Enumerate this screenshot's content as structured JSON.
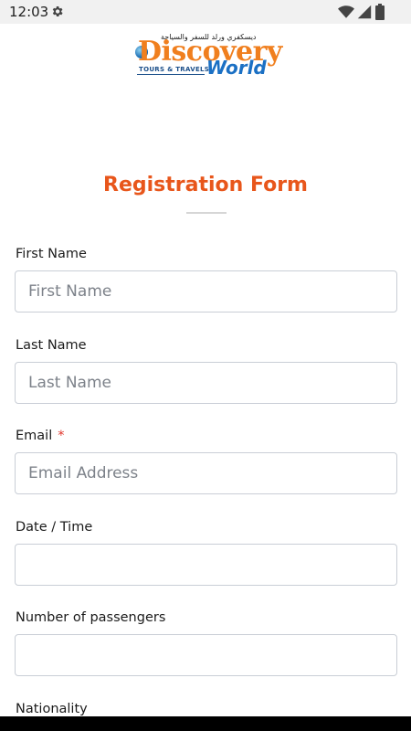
{
  "status_bar": {
    "time": "12:03",
    "icons": [
      "gear-icon",
      "wifi-icon",
      "signal-icon",
      "battery-icon"
    ]
  },
  "logo": {
    "arabic_text": "ديسكفري ورلد للسفر والسياحة",
    "brand_primary": "Discovery",
    "brand_secondary": "World",
    "tagline": "TOURS & TRAVELS"
  },
  "form": {
    "title": "Registration Form",
    "fields": [
      {
        "label": "First Name",
        "placeholder": "First Name",
        "value": "",
        "required": false
      },
      {
        "label": "Last Name",
        "placeholder": "Last Name",
        "value": "",
        "required": false
      },
      {
        "label": "Email",
        "placeholder": "Email Address",
        "value": "",
        "required": true,
        "required_mark": "*"
      },
      {
        "label": "Date / Time",
        "placeholder": "",
        "value": "",
        "required": false
      },
      {
        "label": "Number of passengers",
        "placeholder": "",
        "value": "",
        "required": false
      },
      {
        "label": "Nationality",
        "required": false
      }
    ]
  },
  "colors": {
    "accent": "#e8561b",
    "brand_orange": "#f07f1e",
    "brand_blue": "#1b70c4",
    "required": "#e0352b",
    "input_border": "#c9ced6"
  }
}
